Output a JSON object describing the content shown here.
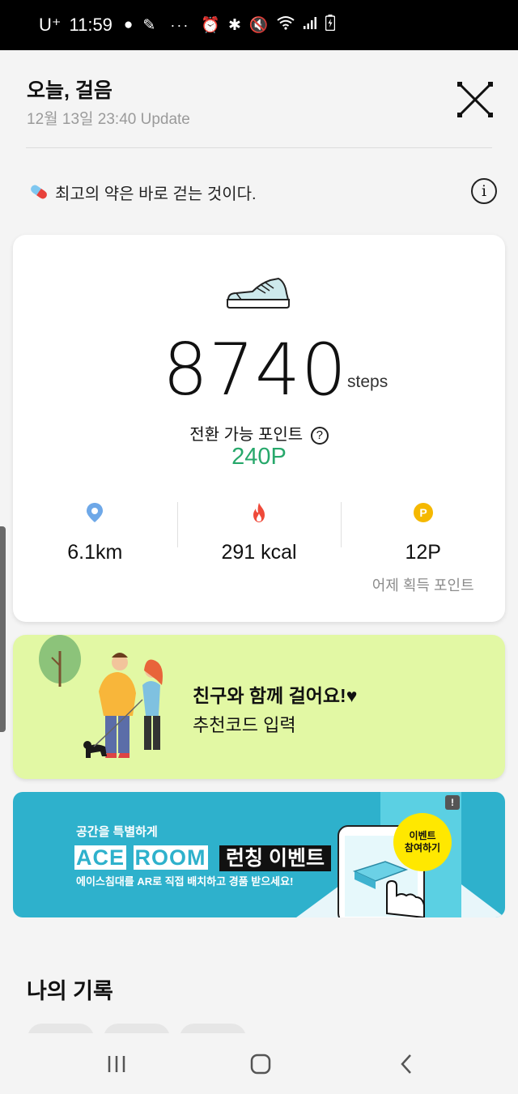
{
  "status_bar": {
    "carrier": "U⁺",
    "time": "11:59",
    "dots": "···"
  },
  "header": {
    "title": "오늘, 걸음",
    "updated": "12월 13일 23:40 Update"
  },
  "tip": {
    "text": "최고의 약은 바로 걷는 것이다.",
    "info_glyph": "i"
  },
  "summary": {
    "steps_value": "8740",
    "steps_unit": "steps",
    "points_label": "전환 가능 포인트",
    "points_help": "?",
    "points_value": "240P",
    "stats": [
      {
        "icon": "location-pin-icon",
        "value": "6.1km",
        "sub": ""
      },
      {
        "icon": "flame-icon",
        "value": "291 kcal",
        "sub": ""
      },
      {
        "icon": "point-coin-icon",
        "value": "12P",
        "sub": "어제 획득 포인트"
      }
    ]
  },
  "banner_friend": {
    "title": "친구와 함께 걸어요!♥",
    "subtitle": "추천코드 입력"
  },
  "banner_ad": {
    "top_line": "공간을 특별하게",
    "brand_a": "ACE",
    "brand_b": "ROOM",
    "event_title": "런칭 이벤트",
    "description": "에이스침대를 AR로 직접 배치하고 경품 받으세요!",
    "badge_line1": "이벤트",
    "badge_line2": "참여하기",
    "ad_mark": "!"
  },
  "records": {
    "title": "나의 기록"
  },
  "colors": {
    "accent_green": "#27a86b",
    "banner_lime": "#e2f8a4",
    "banner_blue": "#2eb1cc",
    "point_yellow": "#f5b800",
    "flame_red": "#ef4a3a",
    "pin_blue": "#6ea8e8"
  }
}
